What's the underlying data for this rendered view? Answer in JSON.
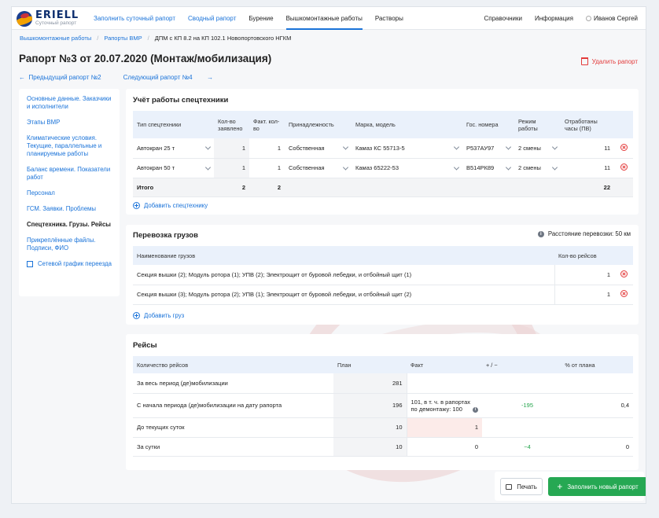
{
  "brand": {
    "name": "ERIELL",
    "subtitle": "Суточный рапорт"
  },
  "nav": {
    "left": [
      "Заполнить суточный рапорт",
      "Сводный рапорт",
      "Бурение",
      "Вышкомонтажные работы",
      "Растворы"
    ],
    "right": [
      "Справочники",
      "Информация"
    ],
    "user": "Иванов Сергей"
  },
  "breadcrumbs": [
    "Вышкомонтажные работы",
    "Рапорты ВМР",
    "ДПМ с КП 8.2 на КП 102.1 Новопортовского НГКМ"
  ],
  "page": {
    "title": "Рапорт №3 от 20.07.2020 (Монтаж/мобилизация)",
    "delete_label": "Удалить рапорт",
    "prev_label": "Предыдущий рапорт №2",
    "next_label": "Следующий рапорт №4"
  },
  "sidebar": {
    "items": [
      "Основные данные. Заказчики и исполнители",
      "Этапы ВМР",
      "Климатические условия. Текущие, параллельные и планируемые работы",
      "Баланс времени. Показатели работ",
      "Персонал",
      "ГСМ. Заявки. Проблемы",
      "Спецтехника. Грузы. Рейсы",
      "Прикреплённые файлы. Подписи, ФИО",
      "Сетевой график переезда"
    ]
  },
  "equipment": {
    "title": "Учёт работы спецтехники",
    "headers": [
      "Тип спецтехники",
      "Кол-во заявлено",
      "Факт. кол-во",
      "Принадлежность",
      "Марка, модель",
      "Гос. номера",
      "Режим работы",
      "Отработаны часы (ПВ)"
    ],
    "rows": [
      {
        "type": "Автокран 25 т",
        "declared": "1",
        "actual": "1",
        "owner": "Собственная",
        "model": "Камаз КС 55713-5",
        "plate": "Р537АУ97",
        "mode": "2 смены",
        "hours": "11"
      },
      {
        "type": "Автокран 50 т",
        "declared": "1",
        "actual": "1",
        "owner": "Собственная",
        "model": "Камаз 65222-53",
        "plate": "В514РК89",
        "mode": "2 смены",
        "hours": "11"
      }
    ],
    "total": {
      "label": "Итого",
      "declared": "2",
      "actual": "2",
      "hours": "22"
    },
    "add_label": "Добавить спецтехнику"
  },
  "cargo": {
    "title": "Перевозка грузов",
    "distance": "Расстояние перевозки: 50 км",
    "headers": [
      "Наименование грузов",
      "Кол-во рейсов"
    ],
    "rows": [
      {
        "name": "Секция вышки (2); Модуль ротора (1); УПВ (2); Электрощит от буровой лебедки, и отбойный щит (1)",
        "trips": "1"
      },
      {
        "name": "Секция вышки (3); Модуль ротора (2); УПВ (1); Электрощит от буровой лебедки, и отбойный щит (2)",
        "trips": "1"
      }
    ],
    "add_label": "Добавить груз"
  },
  "trips": {
    "title": "Рейсы",
    "headers": [
      "Количество рейсов",
      "План",
      "Факт",
      "+ / −",
      "% от плана"
    ],
    "rows": [
      {
        "label": "За весь период (де)мобилизации",
        "plan": "281",
        "fact": "",
        "diff": "",
        "pct": ""
      },
      {
        "label": "С начала периода (де)мобилизации на дату рапорта",
        "plan": "196",
        "fact": "101, в т. ч. в рапортах по демонтажу: 100",
        "diff": "-195",
        "pct": "0,4"
      },
      {
        "label": "До текущих суток",
        "plan": "10",
        "fact": "1",
        "diff": "",
        "pct": ""
      },
      {
        "label": "За сутки",
        "plan": "10",
        "fact": "0",
        "diff": "−4",
        "pct": "0"
      }
    ]
  },
  "footer": {
    "print_label": "Печать",
    "new_label": "Заполнить новый рапорт"
  },
  "colors": {
    "accent": "#1a73d9",
    "danger": "#e33b3b",
    "success": "#26a853",
    "header_bg": "#eaf1fb"
  }
}
